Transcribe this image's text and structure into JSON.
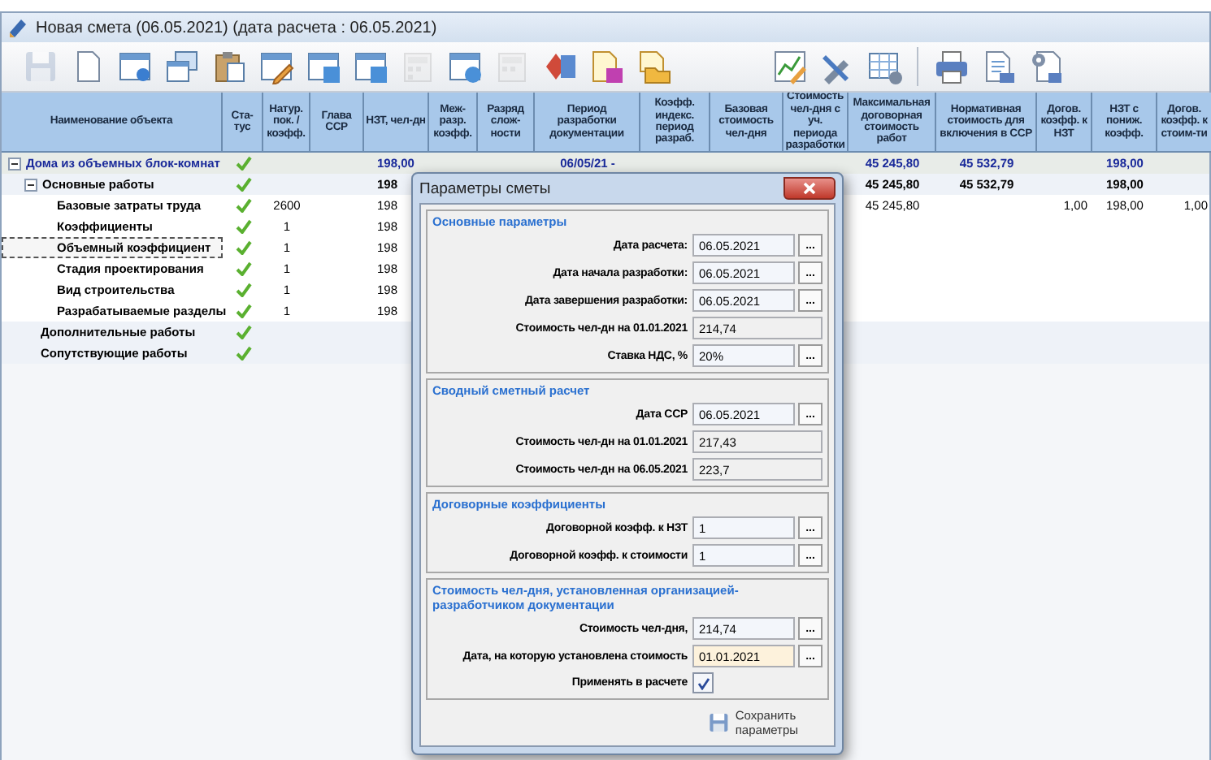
{
  "window": {
    "title": "Новая смета (06.05.2021) (дата расчета : 06.05.2021)"
  },
  "toolbar": [
    [
      {
        "disabled": true
      },
      {
        "disabled": false
      },
      {
        "disabled": false
      },
      {
        "disabled": false
      },
      {
        "disabled": false
      },
      {
        "disabled": false
      },
      {
        "disabled": false
      },
      {
        "disabled": false
      },
      {
        "disabled": true
      },
      {
        "disabled": false
      },
      {
        "disabled": true
      },
      {
        "disabled": false
      },
      {
        "disabled": false
      },
      {
        "disabled": false
      }
    ],
    [
      {
        "disabled": false
      },
      {
        "disabled": false
      },
      {
        "disabled": false
      }
    ],
    [
      {
        "disabled": false
      },
      {
        "disabled": false
      },
      {
        "disabled": false
      }
    ]
  ],
  "table": {
    "columns": [
      "Наименование объекта",
      "Ста-тус",
      "Натур. пок. / коэфф.",
      "Глава ССР",
      "НЗТ, чел-дн",
      "Меж-разр. коэфф.",
      "Разряд слож-ности",
      "Период разработки документации",
      "Коэфф. индекс. период разраб.",
      "Базовая стоимость чел-дня",
      "Стоимость чел-дня с уч. периода разработки",
      "Максимальная договорная стоимость работ",
      "Нормативная стоимость для включения в ССР",
      "Догов. коэфф. к НЗТ",
      "НЗТ с пониж. коэфф.",
      "Догов. коэфф. к стоим-ти"
    ],
    "rows": [
      {
        "name": "Дома из объемных блок-комнат",
        "checked": true,
        "selected": false,
        "expanded": true,
        "nzt": "198,00",
        "period": "06/05/21 -",
        "max_cost": "45 245,80",
        "norm_cost": "45 532,79",
        "nzt_reduced": "198,00",
        "children": [
          {
            "name": "Основные работы",
            "checked": true,
            "selected": false,
            "expanded": true,
            "nzt": "198",
            "max_cost": "45 245,80",
            "norm_cost": "45 532,79",
            "nzt_reduced": "198,00",
            "children": [
              {
                "name": "Базовые затраты труда",
                "checked": true,
                "selected": false,
                "natur": "2600",
                "nzt": "198",
                "max_cost": "45 245,80",
                "dog_nzt": "1,00",
                "nzt_reduced": "198,00",
                "dog_cost": "1,00"
              },
              {
                "name": "Коэффициенты",
                "checked": true,
                "selected": false,
                "natur": "1",
                "nzt": "198"
              },
              {
                "name": "Объемный коэффициент",
                "checked": true,
                "selected": true,
                "natur": "1",
                "nzt": "198"
              },
              {
                "name": "Стадия проектирования",
                "checked": true,
                "selected": false,
                "natur": "1",
                "nzt": "198"
              },
              {
                "name": "Вид строительства",
                "checked": true,
                "selected": false,
                "natur": "1",
                "nzt": "198"
              },
              {
                "name": "Разрабатываемые разделы",
                "checked": true,
                "selected": false,
                "natur": "1",
                "nzt": "198"
              }
            ]
          },
          {
            "name": "Дополнительные работы",
            "checked": true,
            "selected": false
          },
          {
            "name": "Сопутствующие работы",
            "checked": true,
            "selected": false
          }
        ]
      }
    ]
  },
  "dialog": {
    "title": "Параметры сметы",
    "groups": [
      {
        "title": "Основные параметры",
        "fields": [
          {
            "kind": "text",
            "label": "Дата расчета:",
            "value": "06.05.2021",
            "button": "...",
            "readonly": false,
            "focused": false
          },
          {
            "kind": "text",
            "label": "Дата начала разработки:",
            "value": "06.05.2021",
            "button": "...",
            "readonly": false,
            "focused": false
          },
          {
            "kind": "text",
            "label": "Дата завершения разработки:",
            "value": "06.05.2021",
            "button": "...",
            "readonly": false,
            "focused": false
          },
          {
            "kind": "text",
            "label": "Стоимость чел-дн на 01.01.2021",
            "value": "214,74",
            "readonly": true,
            "focused": false
          },
          {
            "kind": "text",
            "label": "Ставка НДС, %",
            "value": "20%",
            "button": "...",
            "readonly": false,
            "focused": false
          }
        ]
      },
      {
        "title": "Сводный сметный расчет",
        "fields": [
          {
            "kind": "text",
            "label": "Дата ССР",
            "value": "06.05.2021",
            "button": "...",
            "readonly": false,
            "focused": false
          },
          {
            "kind": "text",
            "label": "Стоимость чел-дн на 01.01.2021",
            "value": "217,43",
            "readonly": true,
            "focused": false
          },
          {
            "kind": "text",
            "label": "Стоимость чел-дн на 06.05.2021",
            "value": "223,7",
            "readonly": true,
            "focused": false
          }
        ]
      },
      {
        "title": "Договорные коэффициенты",
        "fields": [
          {
            "kind": "text",
            "label": "Договорной коэфф. к НЗТ",
            "value": "1",
            "button": "...",
            "readonly": false,
            "focused": false
          },
          {
            "kind": "text",
            "label": "Договорной коэфф. к стоимости",
            "value": "1",
            "button": "...",
            "readonly": false,
            "focused": false
          }
        ]
      },
      {
        "title": "Стоимость чел-дня, установленная организацией-разработчиком документации",
        "fields": [
          {
            "kind": "text",
            "label": "Стоимость чел-дня,",
            "value": "214,74",
            "button": "...",
            "readonly": false,
            "focused": false
          },
          {
            "kind": "text",
            "label": "Дата, на которую установлена стоимость",
            "value": "01.01.2021",
            "button": "...",
            "readonly": false,
            "focused": true
          },
          {
            "kind": "checkbox",
            "label": "Применять в расчете",
            "checked": true
          }
        ]
      }
    ],
    "save_button": "Сохранить параметры"
  }
}
